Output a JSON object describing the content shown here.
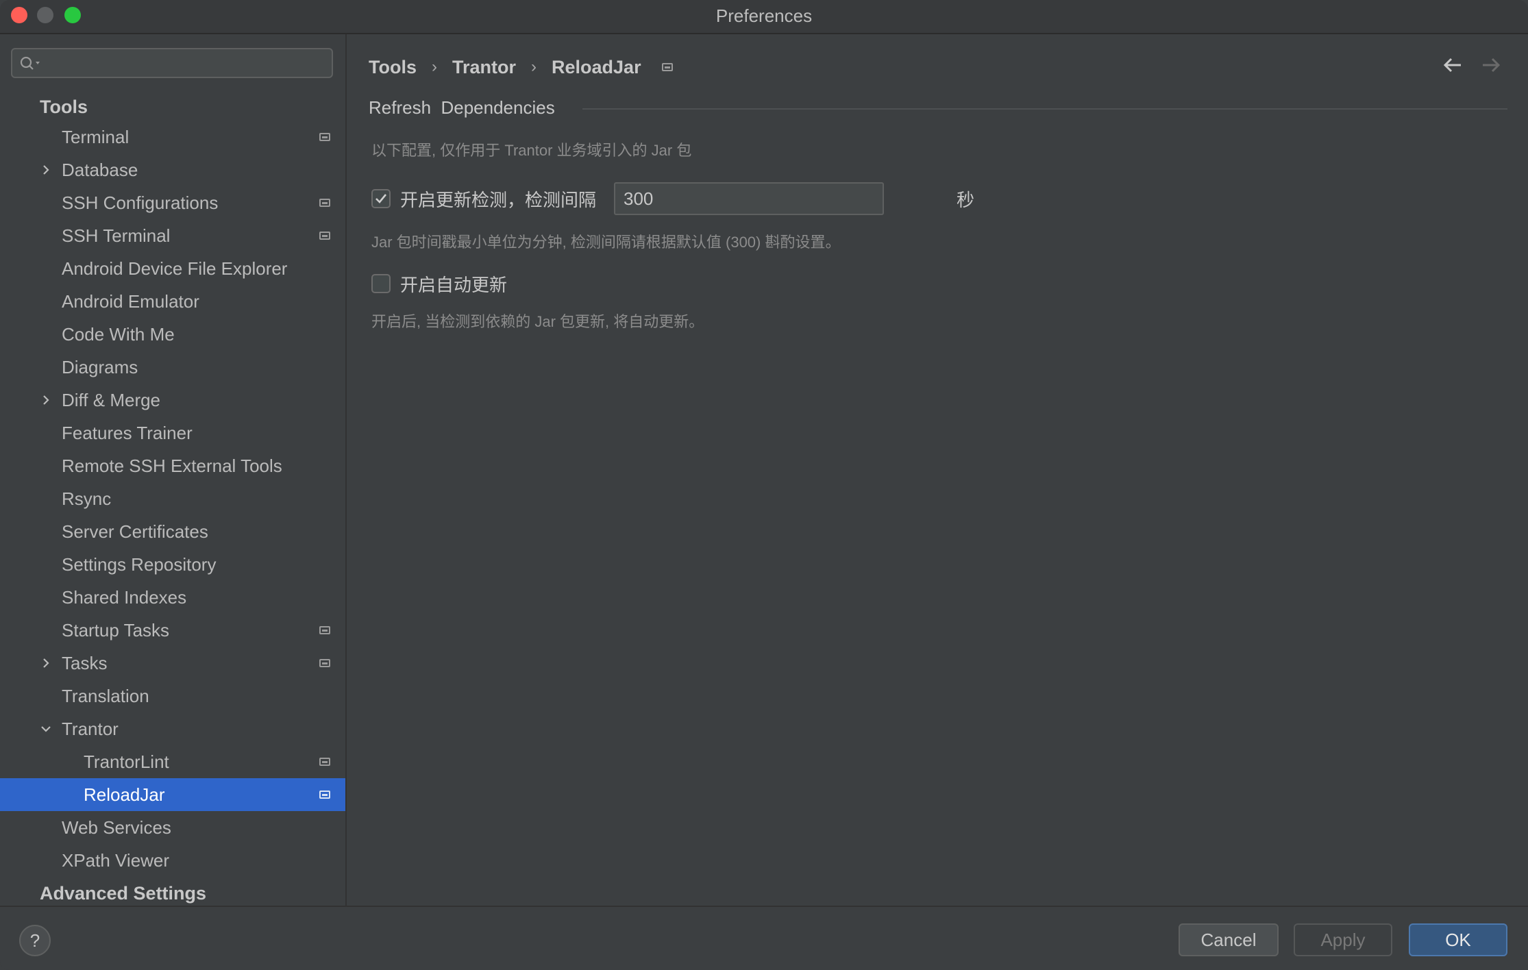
{
  "window": {
    "title": "Preferences"
  },
  "search": {
    "value": "",
    "placeholder": ""
  },
  "sidebar": {
    "section_tools": "Tools",
    "items": [
      {
        "label": "Terminal",
        "expandable": false,
        "pinned": true
      },
      {
        "label": "Database",
        "expandable": true,
        "pinned": false
      },
      {
        "label": "SSH Configurations",
        "expandable": false,
        "pinned": true
      },
      {
        "label": "SSH Terminal",
        "expandable": false,
        "pinned": true
      },
      {
        "label": "Android Device File Explorer",
        "expandable": false,
        "pinned": false
      },
      {
        "label": "Android Emulator",
        "expandable": false,
        "pinned": false
      },
      {
        "label": "Code With Me",
        "expandable": false,
        "pinned": false
      },
      {
        "label": "Diagrams",
        "expandable": false,
        "pinned": false
      },
      {
        "label": "Diff & Merge",
        "expandable": true,
        "pinned": false
      },
      {
        "label": "Features Trainer",
        "expandable": false,
        "pinned": false
      },
      {
        "label": "Remote SSH External Tools",
        "expandable": false,
        "pinned": false
      },
      {
        "label": "Rsync",
        "expandable": false,
        "pinned": false
      },
      {
        "label": "Server Certificates",
        "expandable": false,
        "pinned": false
      },
      {
        "label": "Settings Repository",
        "expandable": false,
        "pinned": false
      },
      {
        "label": "Shared Indexes",
        "expandable": false,
        "pinned": false
      },
      {
        "label": "Startup Tasks",
        "expandable": false,
        "pinned": true
      },
      {
        "label": "Tasks",
        "expandable": true,
        "pinned": true
      },
      {
        "label": "Translation",
        "expandable": false,
        "pinned": false
      },
      {
        "label": "Trantor",
        "expanded": true,
        "pinned": false
      },
      {
        "label": "TrantorLint",
        "child": true,
        "pinned": true
      },
      {
        "label": "ReloadJar",
        "child": true,
        "pinned": true,
        "selected": true
      },
      {
        "label": "Web Services",
        "expandable": false,
        "pinned": false
      },
      {
        "label": "XPath Viewer",
        "expandable": false,
        "pinned": false
      }
    ],
    "section_advanced": "Advanced Settings"
  },
  "breadcrumb": {
    "items": [
      "Tools",
      "Trantor",
      "ReloadJar"
    ]
  },
  "main": {
    "group_title": "Refresh  Dependencies",
    "intro_hint": "以下配置, 仅作用于 Trantor 业务域引入的 Jar 包",
    "update_check": {
      "label": "开启更新检测，检测间隔",
      "checked": true,
      "interval_value": "300",
      "unit": "秒"
    },
    "interval_hint": "Jar 包时间戳最小单位为分钟, 检测间隔请根据默认值 (300) 斟酌设置。",
    "auto_update": {
      "label": "开启自动更新",
      "checked": false
    },
    "auto_update_hint": "开启后, 当检测到依赖的 Jar 包更新, 将自动更新。"
  },
  "footer": {
    "help_label": "?",
    "cancel_label": "Cancel",
    "apply_label": "Apply",
    "ok_label": "OK"
  },
  "colors": {
    "background": "#3c3f41",
    "selection": "#2f65ca",
    "ok_button": "#365880",
    "close": "#ff5f57",
    "maximize": "#28c840"
  }
}
